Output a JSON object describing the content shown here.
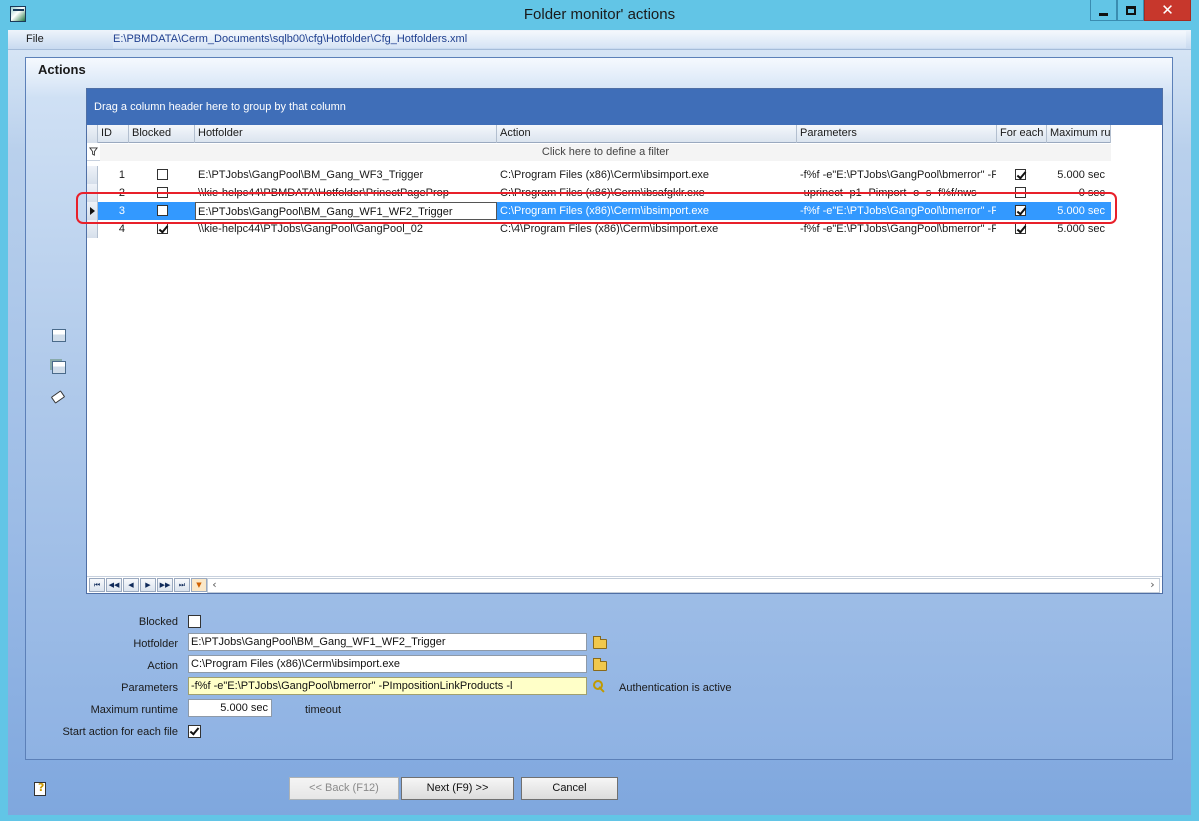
{
  "window": {
    "title": "Folder monitor' actions",
    "close_glyph": "✕"
  },
  "filebar": {
    "label": "File",
    "path": "E:\\PBMDATA\\Cerm_Documents\\sqlb00\\cfg\\Hotfolder\\Cfg_Hotfolders.xml"
  },
  "panel": {
    "title": "Actions"
  },
  "grid": {
    "group_hint": "Drag a column header here to group by that column",
    "filter_hint": "Click here to define a filter",
    "columns": [
      "ID",
      "Blocked",
      "Hotfolder",
      "Action",
      "Parameters",
      "For each",
      "Maximum runtime"
    ],
    "rows": [
      {
        "id": "1",
        "blocked": false,
        "hotfolder": "E:\\PTJobs\\GangPool\\BM_Gang_WF3_Trigger",
        "action": "C:\\Program Files (x86)\\Cerm\\ibsimport.exe",
        "parameters": "-f%f -e\"E:\\PTJobs\\GangPool\\bmerror\" -PImpositionLinkProducts -l",
        "for_each": true,
        "max_runtime": "5.000 sec"
      },
      {
        "id": "2",
        "blocked": false,
        "hotfolder": "\\\\kie-helpc44\\PBMDATA\\Hotfolder\\PrinectPageProp",
        "action": "C:\\Program Files (x86)\\Cerm\\ibsafgklr.exe",
        "parameters": "-uprinect -p1 -Pimport -o -s -f%f/nws",
        "for_each": false,
        "max_runtime": "0 sec"
      },
      {
        "id": "3",
        "blocked": false,
        "hotfolder": "E:\\PTJobs\\GangPool\\BM_Gang_WF1_WF2_Trigger",
        "action": "C:\\Program Files (x86)\\Cerm\\ibsimport.exe",
        "parameters": "-f%f -e\"E:\\PTJobs\\GangPool\\bmerror\" -PImpositionLinkProducts -l",
        "for_each": true,
        "max_runtime": "5.000 sec"
      },
      {
        "id": "4",
        "blocked": true,
        "hotfolder": "\\\\kie-helpc44\\PTJobs\\GangPool\\GangPool_02",
        "action": "C:\\4\\Program Files (x86)\\Cerm\\ibsimport.exe",
        "parameters": "-f%f -e\"E:\\PTJobs\\GangPool\\bmerror\" -PImpositionLinkProducts -l",
        "for_each": true,
        "max_runtime": "5.000 sec"
      }
    ],
    "nav_glyphs": [
      "⏮",
      "◀◀",
      "◀",
      "▶",
      "▶▶",
      "⏭",
      "▼"
    ],
    "scroll_left": "‹",
    "scroll_right": "›"
  },
  "form": {
    "blocked_label": "Blocked",
    "hotfolder_label": "Hotfolder",
    "hotfolder_value": "E:\\PTJobs\\GangPool\\BM_Gang_WF1_WF2_Trigger",
    "action_label": "Action",
    "action_value": "C:\\Program Files (x86)\\Cerm\\ibsimport.exe",
    "parameters_label": "Parameters",
    "parameters_value": "-f%f -e\"E:\\PTJobs\\GangPool\\bmerror\" -PImpositionLinkProducts -l",
    "auth_text": "Authentication is active",
    "max_runtime_label": "Maximum runtime",
    "max_runtime_value": "5.000 sec",
    "timeout_text": "timeout",
    "start_each_label": "Start action for each file",
    "blocked_checked": false,
    "start_each_checked": true
  },
  "buttons": {
    "back": "<< Back (F12)",
    "next": "Next (F9) >>",
    "cancel": "Cancel"
  }
}
